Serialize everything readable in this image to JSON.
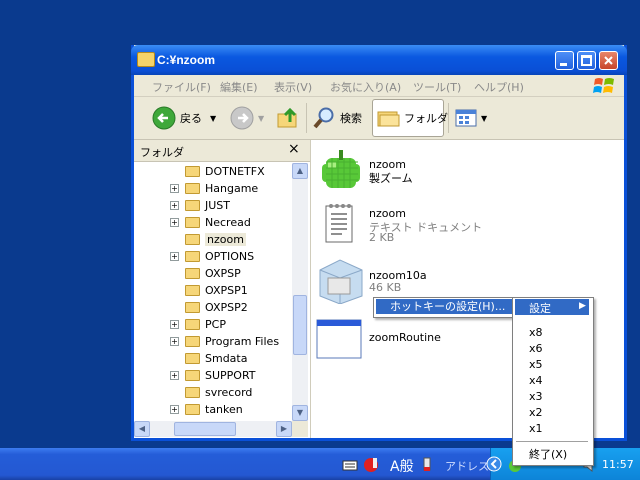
{
  "window": {
    "title": "C:¥nzoom"
  },
  "menubar": [
    "ファイル(F)",
    "編集(E)",
    "表示(V)",
    "お気に入り(A)",
    "ツール(T)",
    "ヘルプ(H)"
  ],
  "toolbar": {
    "back": "戻る",
    "search": "検索",
    "folders": "フォルダ"
  },
  "folder_pane": {
    "title": "フォルダ",
    "close": "×",
    "items": [
      {
        "label": "DOTNETFX",
        "expandable": false
      },
      {
        "label": "Hangame",
        "expandable": true
      },
      {
        "label": "JUST",
        "expandable": true
      },
      {
        "label": "Necread",
        "expandable": true
      },
      {
        "label": "nzoom",
        "expandable": false,
        "selected": true
      },
      {
        "label": "OPTIONS",
        "expandable": true
      },
      {
        "label": "OXPSP",
        "expandable": false
      },
      {
        "label": "OXPSP1",
        "expandable": false
      },
      {
        "label": "OXPSP2",
        "expandable": false
      },
      {
        "label": "PCP",
        "expandable": true
      },
      {
        "label": "Program Files",
        "expandable": true
      },
      {
        "label": "Smdata",
        "expandable": false
      },
      {
        "label": "SUPPORT",
        "expandable": true
      },
      {
        "label": "svrecord",
        "expandable": false
      },
      {
        "label": "tanken",
        "expandable": true
      }
    ]
  },
  "files": [
    {
      "name": "nzoom",
      "sub1": "製ズーム",
      "sub2": ""
    },
    {
      "name": "nzoom",
      "sub1": "テキスト ドキュメント",
      "sub2": "2 KB"
    },
    {
      "name": "nzoom10a",
      "sub1": "46 KB",
      "sub2": ""
    },
    {
      "name": "zoomRoutine",
      "sub1": "",
      "sub2": ""
    }
  ],
  "context_menu": {
    "hotkey": "ホットキーの設定(H)..."
  },
  "submenu": {
    "header": "設定",
    "items": [
      "x8",
      "x6",
      "x5",
      "x4",
      "x3",
      "x2",
      "x1"
    ],
    "exit": "終了(X)"
  },
  "taskbar": {
    "ime": "A般",
    "address": "アドレス",
    "clock": "11:57"
  }
}
